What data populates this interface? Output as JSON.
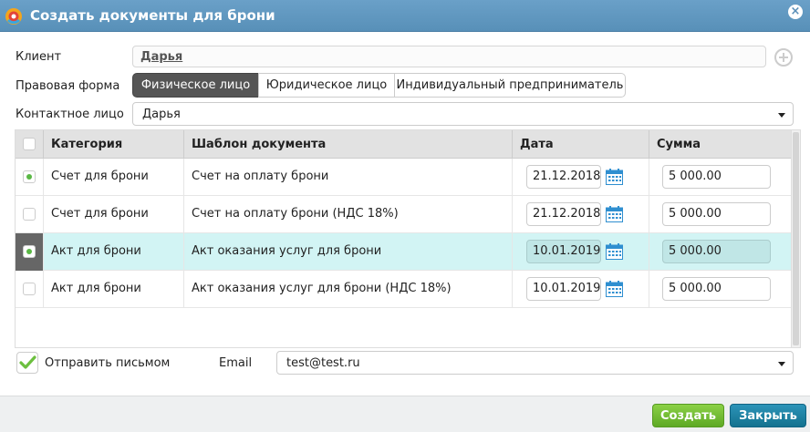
{
  "window": {
    "title": "Создать документы для брони",
    "close_symbol": "×"
  },
  "form": {
    "client_label": "Клиент",
    "client_value": "Дарья",
    "legal_form_label": "Правовая форма",
    "legal_forms": [
      "Физическое лицо",
      "Юридическое лицо",
      "Индивидуальный предприниматель"
    ],
    "legal_form_selected": 0,
    "contact_label": "Контактное лицо",
    "contact_value": "Дарья"
  },
  "grid": {
    "columns": [
      "Категория",
      "Шаблон документа",
      "Дата",
      "Сумма"
    ],
    "rows": [
      {
        "category": "Счет для брони",
        "template": "Счет на оплату брони",
        "date": "21.12.2018",
        "sum": "5 000.00",
        "checked": true,
        "selected": false
      },
      {
        "category": "Счет для брони",
        "template": "Счет на оплату брони (НДС 18%)",
        "date": "21.12.2018",
        "sum": "5 000.00",
        "checked": false,
        "selected": false
      },
      {
        "category": "Акт для брони",
        "template": "Акт оказания услуг для брони",
        "date": "10.01.2019",
        "sum": "5 000.00",
        "checked": true,
        "selected": true
      },
      {
        "category": "Акт для брони",
        "template": "Акт оказания услуг для брони (НДС 18%)",
        "date": "10.01.2019",
        "sum": "5 000.00",
        "checked": false,
        "selected": false
      }
    ]
  },
  "send": {
    "label": "Отправить письмом",
    "checked": true,
    "email_label": "Email",
    "email_value": "test@test.ru"
  },
  "buttons": {
    "create": "Создать",
    "close": "Закрыть"
  },
  "colors": {
    "titlebar": "#5f96bf",
    "selected_row": "#d2f4f4",
    "create_button": "#6fbb31",
    "close_button": "#1c81a2",
    "check_green": "#5ab845"
  }
}
